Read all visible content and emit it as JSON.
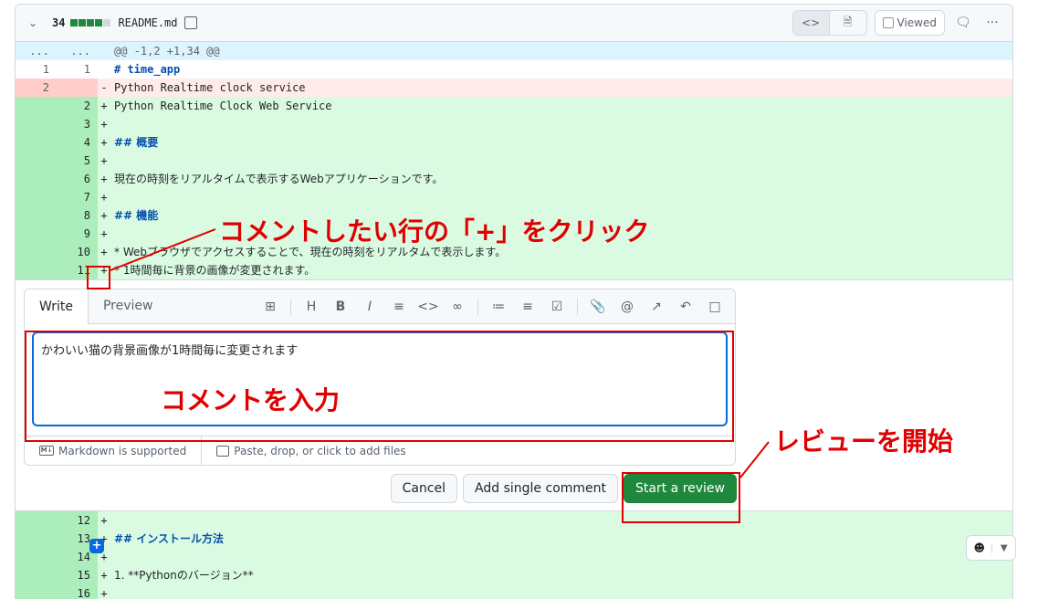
{
  "file": {
    "change_count": "34",
    "name": "README.md",
    "viewed_label": "Viewed"
  },
  "hunk": {
    "left": "...",
    "right": "...",
    "text": "@@ -1,2 +1,34 @@"
  },
  "lines_top": [
    {
      "type": "ctx",
      "old": "1",
      "new": "1",
      "sign": "",
      "text": "# time_app"
    },
    {
      "type": "del",
      "old": "2",
      "new": "",
      "sign": "-",
      "text": "Python Realtime clock service"
    },
    {
      "type": "add",
      "old": "",
      "new": "2",
      "sign": "+",
      "text": "Python Realtime Clock Web Service"
    },
    {
      "type": "add",
      "old": "",
      "new": "3",
      "sign": "+",
      "text": ""
    },
    {
      "type": "add",
      "old": "",
      "new": "4",
      "sign": "+",
      "text": "## 概要"
    },
    {
      "type": "add",
      "old": "",
      "new": "5",
      "sign": "+",
      "text": ""
    },
    {
      "type": "add",
      "old": "",
      "new": "6",
      "sign": "+",
      "text": "現在の時刻をリアルタイムで表示するWebアプリケーションです。"
    },
    {
      "type": "add",
      "old": "",
      "new": "7",
      "sign": "+",
      "text": ""
    },
    {
      "type": "add",
      "old": "",
      "new": "8",
      "sign": "+",
      "text": "## 機能"
    },
    {
      "type": "add",
      "old": "",
      "new": "9",
      "sign": "+",
      "text": ""
    },
    {
      "type": "add",
      "old": "",
      "new": "10",
      "sign": "+",
      "text": "* Webブラウザでアクセスすることで、現在の時刻をリアルタムで表示します。"
    },
    {
      "type": "add",
      "old": "",
      "new": "11",
      "sign": "+",
      "text": "* 1時間毎に背景の画像が変更されます。"
    }
  ],
  "lines_bottom": [
    {
      "type": "add",
      "old": "",
      "new": "12",
      "sign": "+",
      "text": ""
    },
    {
      "type": "add",
      "old": "",
      "new": "13",
      "sign": "+",
      "text": "## インストール方法"
    },
    {
      "type": "add",
      "old": "",
      "new": "14",
      "sign": "+",
      "text": ""
    },
    {
      "type": "add",
      "old": "",
      "new": "15",
      "sign": "+",
      "text": "1. **Pythonのバージョン**"
    },
    {
      "type": "add",
      "old": "",
      "new": "16",
      "sign": "+",
      "text": ""
    }
  ],
  "editor": {
    "tab_write": "Write",
    "tab_preview": "Preview",
    "comment_text": "かわいい猫の背景画像が1時間毎に変更されます",
    "markdown_note": "Markdown is supported",
    "attach_note": "Paste, drop, or click to add files",
    "toolbar_icons": [
      "template-icon",
      "heading-icon",
      "bold-icon",
      "italic-icon",
      "quote-icon",
      "code-icon",
      "link-icon",
      "ordered-list-icon",
      "unordered-list-icon",
      "task-list-icon",
      "attach-icon",
      "mention-icon",
      "reference-icon",
      "undo-icon",
      "slash-command-icon"
    ]
  },
  "buttons": {
    "cancel": "Cancel",
    "single": "Add single comment",
    "review": "Start a review"
  },
  "annotations": {
    "click_plus": "コメントしたい行の「+」をクリック",
    "enter_comment": "コメントを入力",
    "start_review": "レビューを開始"
  },
  "colors": {
    "annotation": "#e00000",
    "primary": "#1f883d",
    "add_bg": "#dafbe1",
    "del_bg": "#ffebe9"
  }
}
